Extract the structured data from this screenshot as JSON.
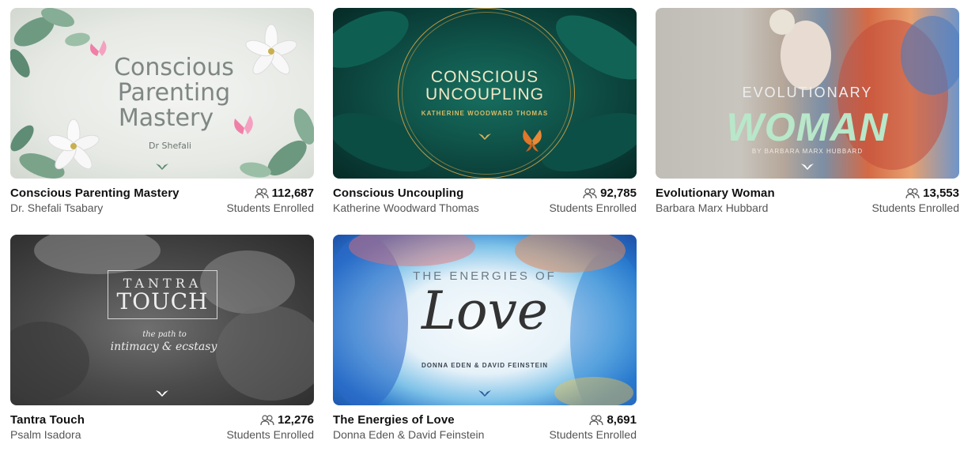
{
  "meta_suffix": "Students Enrolled",
  "courses": [
    {
      "title": "Conscious Parenting Mastery",
      "author": "Dr. Shefali Tsabary",
      "enrolled": "112,687",
      "students_label": "Students Enrolled",
      "art": {
        "line1": "Conscious",
        "line2": "Parenting",
        "line3": "Mastery",
        "byline": "Dr Shefali"
      }
    },
    {
      "title": "Conscious Uncoupling",
      "author": "Katherine Woodward Thomas",
      "enrolled": "92,785",
      "students_label": "Students Enrolled",
      "art": {
        "line1": "CONSCIOUS",
        "line2": "UNCOUPLING",
        "byline": "KATHERINE WOODWARD THOMAS"
      }
    },
    {
      "title": "Evolutionary Woman",
      "author": "Barbara Marx Hubbard",
      "enrolled": "13,553",
      "students_label": "Students Enrolled",
      "art": {
        "line1": "EVOLUTIONARY",
        "line2": "WOMAN",
        "byline": "BY BARBARA MARX HUBBARD"
      }
    },
    {
      "title": "Tantra Touch",
      "author": "Psalm Isadora",
      "enrolled": "12,276",
      "students_label": "Students Enrolled",
      "art": {
        "line1": "TANTRA",
        "line2": "TOUCH",
        "line3": "the path to",
        "line4": "intimacy & ecstasy"
      }
    },
    {
      "title": "The Energies of Love",
      "author": "Donna Eden & David Feinstein",
      "enrolled": "8,691",
      "students_label": "Students Enrolled",
      "art": {
        "line1": "THE ENERGIES OF",
        "line2": "Love",
        "byline": "DONNA EDEN & DAVID FEINSTEIN"
      }
    }
  ],
  "icons": {
    "enrolled": "people-icon",
    "brand": "mindvalley-logo-icon"
  },
  "colors": {
    "title": "#111111",
    "muted": "#555555"
  }
}
